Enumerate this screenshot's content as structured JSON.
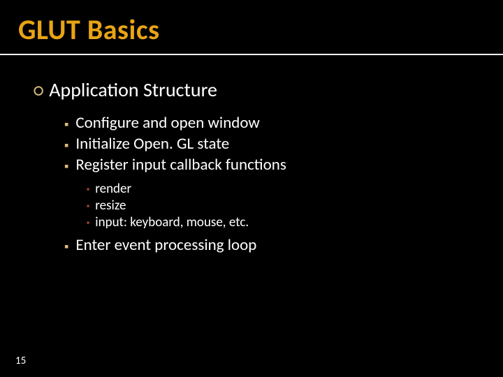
{
  "slide": {
    "title": "GLUT Basics",
    "pageNumber": "15",
    "section": {
      "heading": "Application Structure",
      "items": [
        {
          "text": "Configure and open window"
        },
        {
          "text": "Initialize Open. GL state"
        },
        {
          "text": "Register input callback functions",
          "sub": [
            "render",
            "resize",
            "input: keyboard, mouse, etc."
          ]
        },
        {
          "text": "Enter event processing loop"
        }
      ]
    }
  }
}
